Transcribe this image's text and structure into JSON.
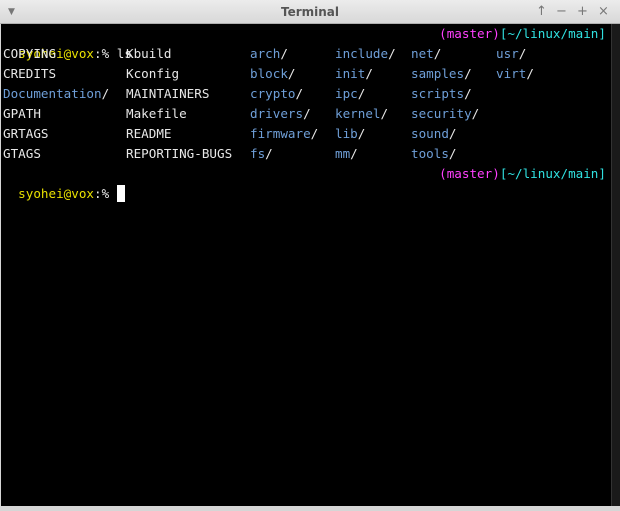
{
  "window": {
    "title": "Terminal",
    "menu_icon": "triangle-down-icon",
    "buttons": [
      "↑",
      "−",
      "+",
      "×"
    ]
  },
  "prompt": {
    "user_host": "syohei@vox",
    "symbol": ":%",
    "command": " ls",
    "branch": "master",
    "path": "~/linux/main"
  },
  "listing": {
    "columns": [
      [
        {
          "name": "COPYING",
          "dir": false
        },
        {
          "name": "CREDITS",
          "dir": false
        },
        {
          "name": "Documentation",
          "dir": true
        },
        {
          "name": "GPATH",
          "dir": false
        },
        {
          "name": "GRTAGS",
          "dir": false
        },
        {
          "name": "GTAGS",
          "dir": false
        }
      ],
      [
        {
          "name": "Kbuild",
          "dir": false
        },
        {
          "name": "Kconfig",
          "dir": false
        },
        {
          "name": "MAINTAINERS",
          "dir": false
        },
        {
          "name": "Makefile",
          "dir": false
        },
        {
          "name": "README",
          "dir": false
        },
        {
          "name": "REPORTING-BUGS",
          "dir": false
        }
      ],
      [
        {
          "name": "arch",
          "dir": true
        },
        {
          "name": "block",
          "dir": true
        },
        {
          "name": "crypto",
          "dir": true
        },
        {
          "name": "drivers",
          "dir": true
        },
        {
          "name": "firmware",
          "dir": true
        },
        {
          "name": "fs",
          "dir": true
        }
      ],
      [
        {
          "name": "include",
          "dir": true
        },
        {
          "name": "init",
          "dir": true
        },
        {
          "name": "ipc",
          "dir": true
        },
        {
          "name": "kernel",
          "dir": true
        },
        {
          "name": "lib",
          "dir": true
        },
        {
          "name": "mm",
          "dir": true
        }
      ],
      [
        {
          "name": "net",
          "dir": true
        },
        {
          "name": "samples",
          "dir": true
        },
        {
          "name": "scripts",
          "dir": true
        },
        {
          "name": "security",
          "dir": true
        },
        {
          "name": "sound",
          "dir": true
        },
        {
          "name": "tools",
          "dir": true
        }
      ],
      [
        {
          "name": "usr",
          "dir": true
        },
        {
          "name": "virt",
          "dir": true
        }
      ]
    ]
  },
  "colors": {
    "directory": "#6f9fd8",
    "prompt": "#e8e000",
    "branch": "#ff40ff",
    "path": "#30e0e0",
    "background": "#000000"
  }
}
